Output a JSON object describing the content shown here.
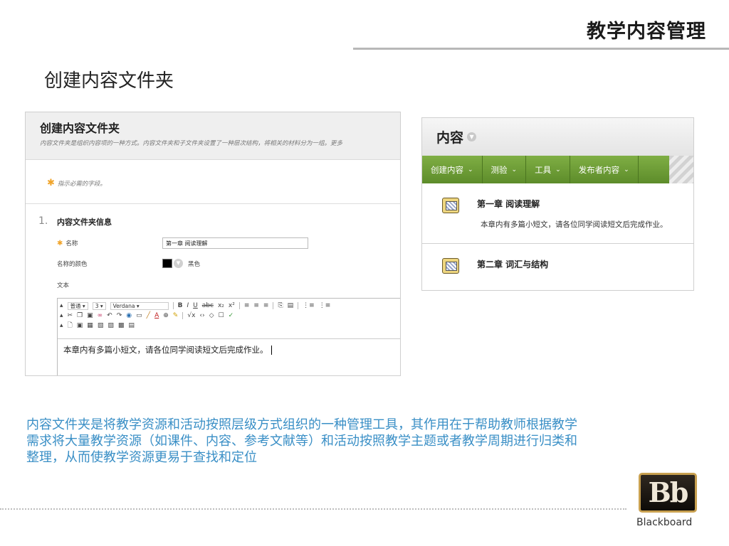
{
  "slide": {
    "title": "教学内容管理",
    "section_heading": "创建内容文件夹",
    "description": "内容文件夹是将教学资源和活动按照层级方式组织的一种管理工具，其作用在于帮助教师根据教学需求将大量教学资源（如课件、内容、参考文献等）和活动按照教学主题或者教学周期进行归类和整理，从而使教学资源更易于查找和定位"
  },
  "form": {
    "title": "创建内容文件夹",
    "description": "内容文件夹是组织内容项的一种方式。内容文件夹和子文件夹设置了一种层次结构，将相关的材料分为一组。更多",
    "required_note": "指示必需的字段。",
    "section_number": "1.",
    "section_title": "内容文件夹信息",
    "name_label": "名称",
    "name_value": "第一章 阅读理解",
    "color_label": "名称的颜色",
    "color_value": "黑色",
    "text_label": "文本",
    "toolbar": {
      "paragraph": "普通",
      "size": "3",
      "font": "Verdana"
    },
    "editor_text": "本章内有多篇小短文，请各位同学阅读短文后完成作业。"
  },
  "content": {
    "title": "内容",
    "actions": [
      {
        "label": "创建内容"
      },
      {
        "label": "测验"
      },
      {
        "label": "工具"
      },
      {
        "label": "发布者内容"
      }
    ],
    "items": [
      {
        "title": "第一章 阅读理解",
        "description": "本章内有多篇小短文，请各位同学阅读短文后完成作业。"
      },
      {
        "title": "第二章 词汇与结构",
        "description": ""
      }
    ]
  },
  "brand": {
    "logo_text": "Bb",
    "wordmark": "Blackboard",
    "accent_green": "#6b9b35",
    "description_blue": "#3a8fc6"
  }
}
